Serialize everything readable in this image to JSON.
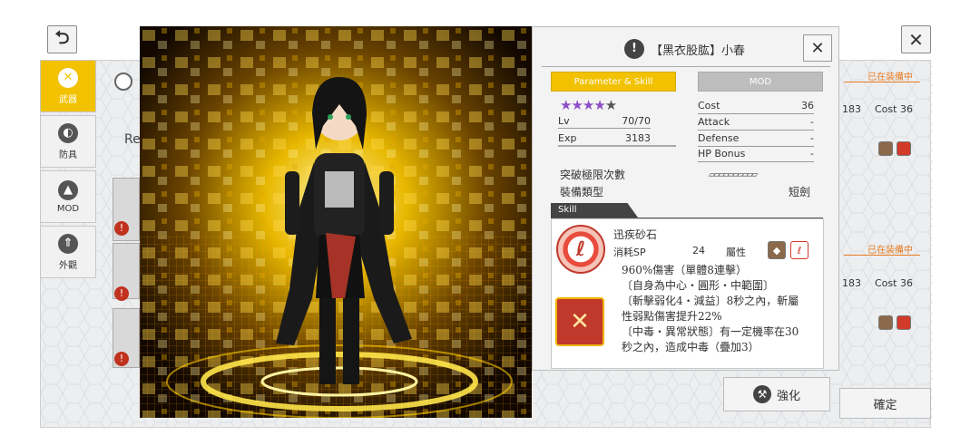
{
  "top": {
    "back_icon": "back-arrow-icon",
    "close_icon": "close-icon"
  },
  "sidebar": {
    "items": [
      {
        "label": "武器",
        "icon": "weapon-icon",
        "active": true
      },
      {
        "label": "防具",
        "icon": "armor-icon"
      },
      {
        "label": "MOD",
        "icon": "mod-icon"
      },
      {
        "label": "外觀",
        "icon": "appearance-icon"
      }
    ]
  },
  "background": {
    "partial_label": "Re",
    "equip_tag_1": "已在装備中",
    "equip_tag_2": "已在装備中",
    "stat_num_1": "183",
    "cost_1": "Cost  36",
    "stat_num_2": "183",
    "cost_2": "Cost  36",
    "confirm": "確定"
  },
  "dialog": {
    "title": "【黑衣股肱】小春",
    "tabs": {
      "param": "Parameter & Skill",
      "mod": "MOD"
    },
    "stars": 5,
    "lv_label": "Lv",
    "lv_value": "70/70",
    "exp_label": "Exp",
    "exp_value": "3183",
    "cost_label": "Cost",
    "cost_value": "36",
    "attack_label": "Attack",
    "attack_value": "-",
    "defense_label": "Defense",
    "defense_value": "-",
    "hp_label": "HP Bonus",
    "hp_value": "-",
    "breakthrough_label": "突破極限次數",
    "equip_type_label": "裝備類型",
    "equip_type_value": "短劍",
    "skill_tab": "Skill",
    "skill_name": "迅疾砂石",
    "sp_label": "消耗SP",
    "sp_value": "24",
    "attr_label": "屬性",
    "desc": [
      "960%傷害（單體8連擊）",
      "〔自身為中心・圓形・中範圍〕",
      "〔斬擊弱化4・減益〕8秒之內，斬屬",
      "性弱點傷害提升22%",
      "〔中毒・異常狀態〕有一定機率在30",
      "秒之內，造成中毒（疊加3）"
    ],
    "enhance": "強化"
  },
  "colors": {
    "accent": "#f2c200",
    "tab_gold": "#f2c200",
    "tag_orange": "#e87a1e",
    "attr_red": "#d23a2a"
  }
}
